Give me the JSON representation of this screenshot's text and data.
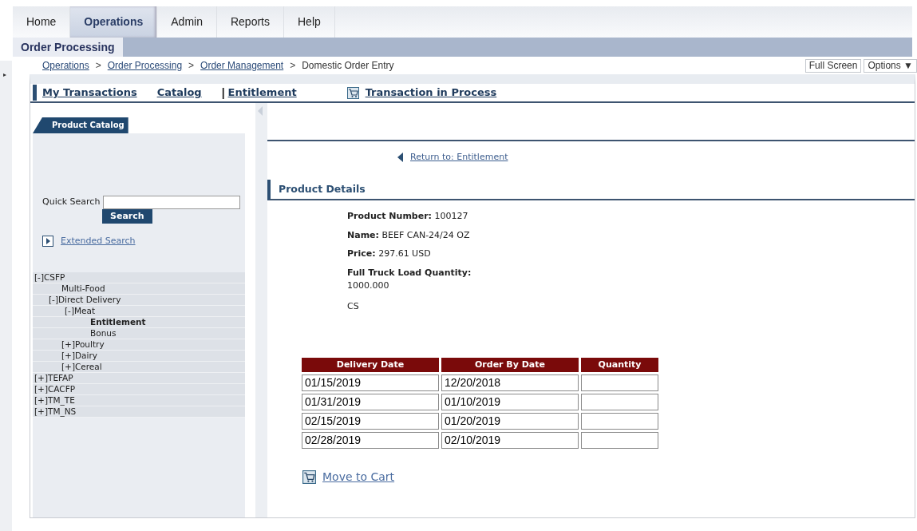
{
  "tabs": [
    {
      "label": "Home",
      "selected": false
    },
    {
      "label": "Operations",
      "selected": true
    },
    {
      "label": "Admin",
      "selected": false
    },
    {
      "label": "Reports",
      "selected": false
    },
    {
      "label": "Help",
      "selected": false
    }
  ],
  "subtabs": [
    {
      "label": "Order Processing",
      "selected": true
    }
  ],
  "breadcrumb": [
    "Operations",
    "Order Processing",
    "Order Management",
    "Domestic Order Entry"
  ],
  "breadcrumb_separator": ">",
  "side_toggle": "▸",
  "links_separator": "|",
  "header_buttons": [
    {
      "label": "Full Screen",
      "kind": "plain"
    },
    {
      "label": "Options",
      "kind": "menu",
      "caret": "▼"
    }
  ],
  "links_bar": [
    {
      "label": "My Transactions",
      "kind": "first"
    },
    {
      "label": "Catalog",
      "kind": "plain"
    },
    {
      "label": "Entitlement",
      "kind": "bar"
    },
    {
      "label": "Transaction in Process",
      "kind": "cart"
    }
  ],
  "sidebar": {
    "title": "Product Catalog",
    "quick_search_label": "Quick Search",
    "search_button": "Search",
    "extended_search": "Extended Search",
    "tree": [
      {
        "label": "[-]CSFP",
        "selected": false,
        "children": [
          {
            "label": "Multi-Food",
            "selected": false
          },
          {
            "label": "[-]Direct Delivery",
            "selected": false,
            "children": [
              {
                "label": "[-]Meat",
                "selected": false,
                "children": [
                  {
                    "label": "Entitlement",
                    "selected": true
                  },
                  {
                    "label": "Bonus",
                    "selected": false
                  }
                ]
              },
              {
                "label": "[+]Poultry",
                "selected": false
              },
              {
                "label": "[+]Dairy",
                "selected": false
              },
              {
                "label": "[+]Cereal",
                "selected": false
              }
            ]
          }
        ]
      },
      {
        "label": "[+]TEFAP",
        "selected": false
      },
      {
        "label": "[+]CACFP",
        "selected": false
      },
      {
        "label": "[+]TM_TE",
        "selected": false
      },
      {
        "label": "[+]TM_NS",
        "selected": false
      }
    ]
  },
  "return_link": "Return to: Entitlement",
  "section_title": "Product Details",
  "details": [
    {
      "label": "Product Number:",
      "value": "100127"
    },
    {
      "label": "Name:",
      "value": "BEEF CAN-24/24 OZ"
    },
    {
      "label": "Price:",
      "value": "297.61 USD"
    },
    {
      "label": "Full Truck Load Quantity:",
      "value": "1000.000",
      "kind": "block"
    }
  ],
  "unit": "CS",
  "table": {
    "columns": [
      "Delivery Date",
      "Order By Date",
      "Quantity"
    ],
    "rows": [
      [
        "01/15/2019",
        "12/20/2018"
      ],
      [
        "01/31/2019",
        "01/10/2019"
      ],
      [
        "02/15/2019",
        "01/20/2019"
      ],
      [
        "02/28/2019",
        "02/10/2019"
      ]
    ]
  },
  "cart_link": "Move to Cart"
}
